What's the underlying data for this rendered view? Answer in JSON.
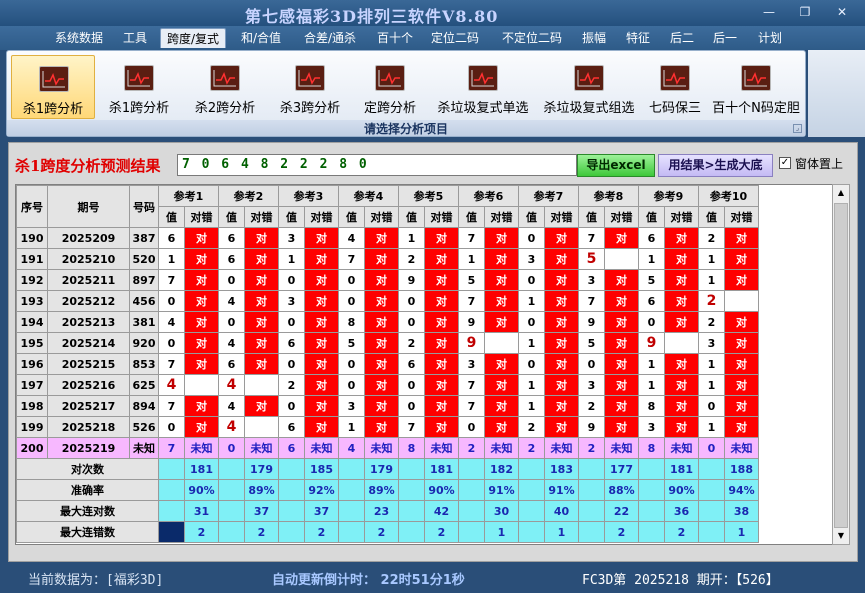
{
  "title": "第七感福彩3D排列三软件V8.80",
  "window_buttons": {
    "minimize": "—",
    "restore": "❐",
    "close": "✕"
  },
  "menu": [
    "系统数据",
    "工具",
    "跨度/复式",
    "和/合值",
    "合差/通杀",
    "百十个",
    "定位二码",
    "不定位二码",
    "振幅",
    "特征",
    "后二",
    "后一",
    "计划"
  ],
  "menu_active_index": 2,
  "ribbon": {
    "tools": [
      "杀1跨分析",
      "杀1跨分析",
      "杀2跨分析",
      "杀3跨分析",
      "定跨分析",
      "杀垃圾复式单选",
      "杀垃圾复式组选",
      "七码保三",
      "百十个N码定胆"
    ],
    "active_index": 0,
    "caption": "请选择分析项目",
    "expand_glyph": "⌟"
  },
  "panel": {
    "result_label": "杀1跨度分析预测结果",
    "result_value": "7 0 6 4 8 2 2 2 8 0",
    "excel_button": "导出excel",
    "generate_button": "用结果>生成大底",
    "checkbox_checked": true,
    "checkbox_mark": "✓",
    "checkbox_label": "窗体置上"
  },
  "grid": {
    "headers": {
      "seq": "序号",
      "period": "期号",
      "number": "号码",
      "value": "值",
      "result": "对错"
    },
    "refs": [
      "参考1",
      "参考2",
      "参考3",
      "参考4",
      "参考5",
      "参考6",
      "参考7",
      "参考8",
      "参考9",
      "参考10"
    ],
    "hit_text": "对",
    "rows": [
      {
        "seq": "190",
        "period": "2025209",
        "number": "387",
        "vals": [
          "6",
          "6",
          "3",
          "4",
          "1",
          "7",
          "0",
          "7",
          "6",
          "2"
        ],
        "hits": [
          1,
          1,
          1,
          1,
          1,
          1,
          1,
          1,
          1,
          1
        ],
        "big": []
      },
      {
        "seq": "191",
        "period": "2025210",
        "number": "520",
        "vals": [
          "1",
          "6",
          "1",
          "7",
          "2",
          "1",
          "3",
          "5",
          "1",
          "1"
        ],
        "hits": [
          1,
          1,
          1,
          1,
          1,
          1,
          1,
          0,
          1,
          1
        ],
        "big": [
          7
        ]
      },
      {
        "seq": "192",
        "period": "2025211",
        "number": "897",
        "vals": [
          "7",
          "0",
          "0",
          "0",
          "9",
          "5",
          "0",
          "3",
          "5",
          "1"
        ],
        "hits": [
          1,
          1,
          1,
          1,
          1,
          1,
          1,
          1,
          1,
          1
        ],
        "big": []
      },
      {
        "seq": "193",
        "period": "2025212",
        "number": "456",
        "vals": [
          "0",
          "4",
          "3",
          "0",
          "0",
          "7",
          "1",
          "7",
          "6",
          "2"
        ],
        "hits": [
          1,
          1,
          1,
          1,
          1,
          1,
          1,
          1,
          1,
          0
        ],
        "big": [
          9
        ]
      },
      {
        "seq": "194",
        "period": "2025213",
        "number": "381",
        "vals": [
          "4",
          "0",
          "0",
          "8",
          "0",
          "9",
          "0",
          "9",
          "0",
          "2"
        ],
        "hits": [
          1,
          1,
          1,
          1,
          1,
          1,
          1,
          1,
          1,
          1
        ],
        "big": []
      },
      {
        "seq": "195",
        "period": "2025214",
        "number": "920",
        "vals": [
          "0",
          "4",
          "6",
          "5",
          "2",
          "9",
          "1",
          "5",
          "9",
          "3"
        ],
        "hits": [
          1,
          1,
          1,
          1,
          1,
          0,
          1,
          1,
          0,
          1
        ],
        "big": [
          5,
          8
        ]
      },
      {
        "seq": "196",
        "period": "2025215",
        "number": "853",
        "vals": [
          "7",
          "6",
          "0",
          "0",
          "6",
          "3",
          "0",
          "0",
          "1",
          "1"
        ],
        "hits": [
          1,
          1,
          1,
          1,
          1,
          1,
          1,
          1,
          1,
          1
        ],
        "big": []
      },
      {
        "seq": "197",
        "period": "2025216",
        "number": "625",
        "vals": [
          "4",
          "4",
          "2",
          "0",
          "0",
          "7",
          "1",
          "3",
          "1",
          "1"
        ],
        "hits": [
          0,
          0,
          1,
          1,
          1,
          1,
          1,
          1,
          1,
          1
        ],
        "big": [
          0,
          1
        ]
      },
      {
        "seq": "198",
        "period": "2025217",
        "number": "894",
        "vals": [
          "7",
          "4",
          "0",
          "3",
          "0",
          "7",
          "1",
          "2",
          "8",
          "0"
        ],
        "hits": [
          1,
          1,
          1,
          1,
          1,
          1,
          1,
          1,
          1,
          1
        ],
        "big": []
      },
      {
        "seq": "199",
        "period": "2025218",
        "number": "526",
        "vals": [
          "0",
          "4",
          "6",
          "1",
          "7",
          "0",
          "2",
          "9",
          "3",
          "1"
        ],
        "hits": [
          1,
          0,
          1,
          1,
          1,
          1,
          1,
          1,
          1,
          1
        ],
        "big": [
          1
        ]
      }
    ],
    "unknown_row": {
      "seq": "200",
      "period": "2025219",
      "number": "未知",
      "vals": [
        "7",
        "0",
        "6",
        "4",
        "8",
        "2",
        "2",
        "2",
        "8",
        "0"
      ],
      "result_text": "未知"
    },
    "stats": [
      {
        "label": "对次数",
        "values": [
          "181",
          "179",
          "185",
          "179",
          "181",
          "182",
          "183",
          "177",
          "181",
          "188"
        ]
      },
      {
        "label": "准确率",
        "values": [
          "90%",
          "89%",
          "92%",
          "89%",
          "90%",
          "91%",
          "91%",
          "88%",
          "90%",
          "94%"
        ]
      },
      {
        "label": "最大连对数",
        "values": [
          "31",
          "37",
          "37",
          "23",
          "42",
          "30",
          "40",
          "22",
          "36",
          "38"
        ]
      },
      {
        "label": "最大连错数",
        "values": [
          "2",
          "2",
          "2",
          "2",
          "2",
          "1",
          "1",
          "2",
          "2",
          "1"
        ]
      }
    ]
  },
  "scrollbar": {
    "up": "▲",
    "down": "▼"
  },
  "status": {
    "source": "当前数据为：[福彩3D]",
    "timer": "自动更新倒计时：  22时51分1秒",
    "issue": "FC3D第 2025218 期开：【526】"
  },
  "colors": {
    "hit": "#ff0000",
    "unknown_row": "#f7b8ff",
    "stat_row": "#7ff0f6",
    "excel_button": "#3ec83a"
  }
}
